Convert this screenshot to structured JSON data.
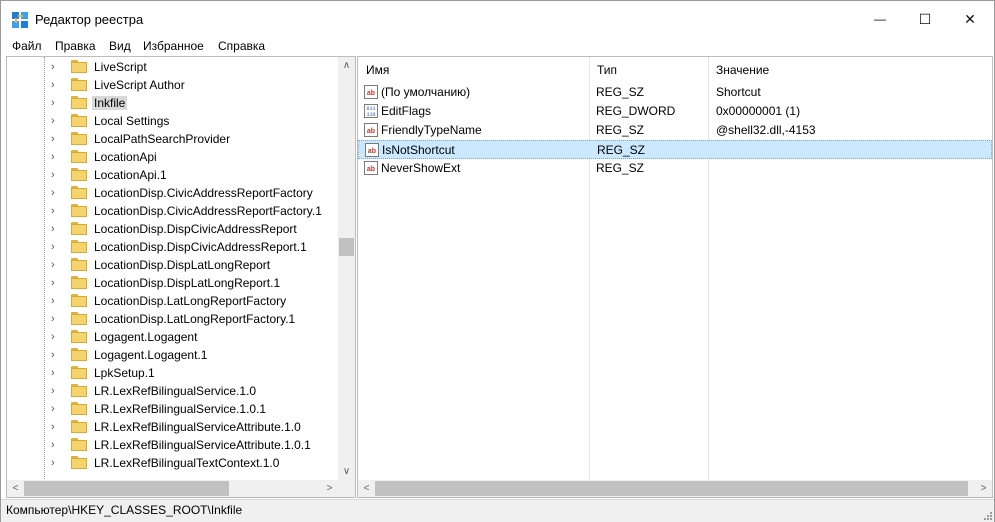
{
  "window": {
    "title": "Редактор реестра",
    "minimize_glyph": "—",
    "maximize_glyph": "☐",
    "close_glyph": "✕"
  },
  "menu": [
    "Файл",
    "Правка",
    "Вид",
    "Избранное",
    "Справка"
  ],
  "tree": {
    "selected": "Inkfile",
    "items": [
      "LiveScript",
      "LiveScript Author",
      "Inkfile",
      "Local Settings",
      "LocalPathSearchProvider",
      "LocationApi",
      "LocationApi.1",
      "LocationDisp.CivicAddressReportFactory",
      "LocationDisp.CivicAddressReportFactory.1",
      "LocationDisp.DispCivicAddressReport",
      "LocationDisp.DispCivicAddressReport.1",
      "LocationDisp.DispLatLongReport",
      "LocationDisp.DispLatLongReport.1",
      "LocationDisp.LatLongReportFactory",
      "LocationDisp.LatLongReportFactory.1",
      "Logagent.Logagent",
      "Logagent.Logagent.1",
      "LpkSetup.1",
      "LR.LexRefBilingualService.1.0",
      "LR.LexRefBilingualService.1.0.1",
      "LR.LexRefBilingualServiceAttribute.1.0",
      "LR.LexRefBilingualServiceAttribute.1.0.1",
      "LR.LexRefBilingualTextContext.1.0"
    ]
  },
  "values": {
    "columns": [
      "Имя",
      "Тип",
      "Значение"
    ],
    "selected_index": 3,
    "rows": [
      {
        "icon": "string-value-icon",
        "name": "(По умолчанию)",
        "type": "REG_SZ",
        "data": "Shortcut"
      },
      {
        "icon": "binary-value-icon",
        "name": "EditFlags",
        "type": "REG_DWORD",
        "data": "0x00000001 (1)"
      },
      {
        "icon": "string-value-icon",
        "name": "FriendlyTypeName",
        "type": "REG_SZ",
        "data": "@shell32.dll,-4153"
      },
      {
        "icon": "string-value-icon",
        "name": "IsNotShortcut",
        "type": "REG_SZ",
        "data": ""
      },
      {
        "icon": "string-value-icon",
        "name": "NeverShowExt",
        "type": "REG_SZ",
        "data": ""
      }
    ]
  },
  "status": {
    "path": "Компьютер\\HKEY_CLASSES_ROOT\\Inkfile"
  },
  "colors": {
    "selection_bg": "#cce8ff",
    "tree_selection_bg": "#d9d9d9",
    "folder_yellow": "#f6d36b"
  }
}
